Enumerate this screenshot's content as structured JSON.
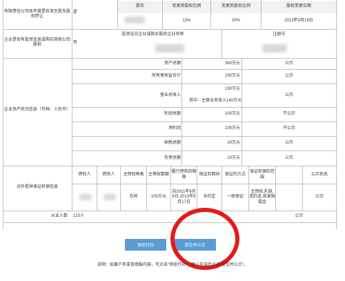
{
  "equity_change": {
    "question": "有限责任公司本年度是否发生股东股权转让",
    "answer": "是",
    "headers": [
      "股东",
      "变更前股权比例",
      "变更后股权比例",
      "股权变更日期"
    ],
    "row": {
      "before": "12%",
      "after": "30%",
      "date": "2013年9月19日"
    }
  },
  "investment": {
    "question": "企业是否有投资信息或购买其他公司股权",
    "answer": "有",
    "headers": [
      "投资设立企业或购买股权企业名称",
      "注册号"
    ]
  },
  "assets": {
    "section_label": "企业资产状况信息（币种：人民币）",
    "rows": [
      {
        "name": "资产总额",
        "value": "360万元",
        "status": "公示"
      },
      {
        "name": "所有者权益合计",
        "value": "230万元",
        "status": "公示"
      },
      {
        "name": "营业总收入",
        "value": "130万元",
        "status": "公示",
        "sub": "其中：主营业务收入140万元"
      },
      {
        "name": "利润总额",
        "value": "100万元",
        "status": "不公示"
      },
      {
        "name": "净利润",
        "value": "100万元",
        "status": "不公示"
      },
      {
        "name": "纳税总额",
        "value": "10万元",
        "status": "公示"
      },
      {
        "name": "负债总额",
        "value": "10万元",
        "status": "公示"
      }
    ]
  },
  "guarantee": {
    "section_label": "对外提供保证担保信息",
    "headers": [
      "债权人",
      "债务人",
      "主债权种类",
      "主债权数额",
      "履行债务的期限",
      "保证的期间",
      "保证的方式",
      "保证担保的范围",
      "公示状态"
    ],
    "row": {
      "type": "合同",
      "amount": "100万元",
      "period": "自2011年9月6日-2013年9月17日",
      "guarantee_period": "未约定",
      "method": "一般保证",
      "scope": "主债权,利息,违约金,损害赔偿金",
      "status": "公示"
    }
  },
  "employees": {
    "label": "从业人数",
    "value": "123人",
    "status": "公示"
  },
  "buttons": {
    "print": "预览打印",
    "submit": "提交并公示"
  },
  "footer_note": "说明：如果户有拿查填报内容，可点击“预览打印”，确认无误后点击“提交并公示”。"
}
